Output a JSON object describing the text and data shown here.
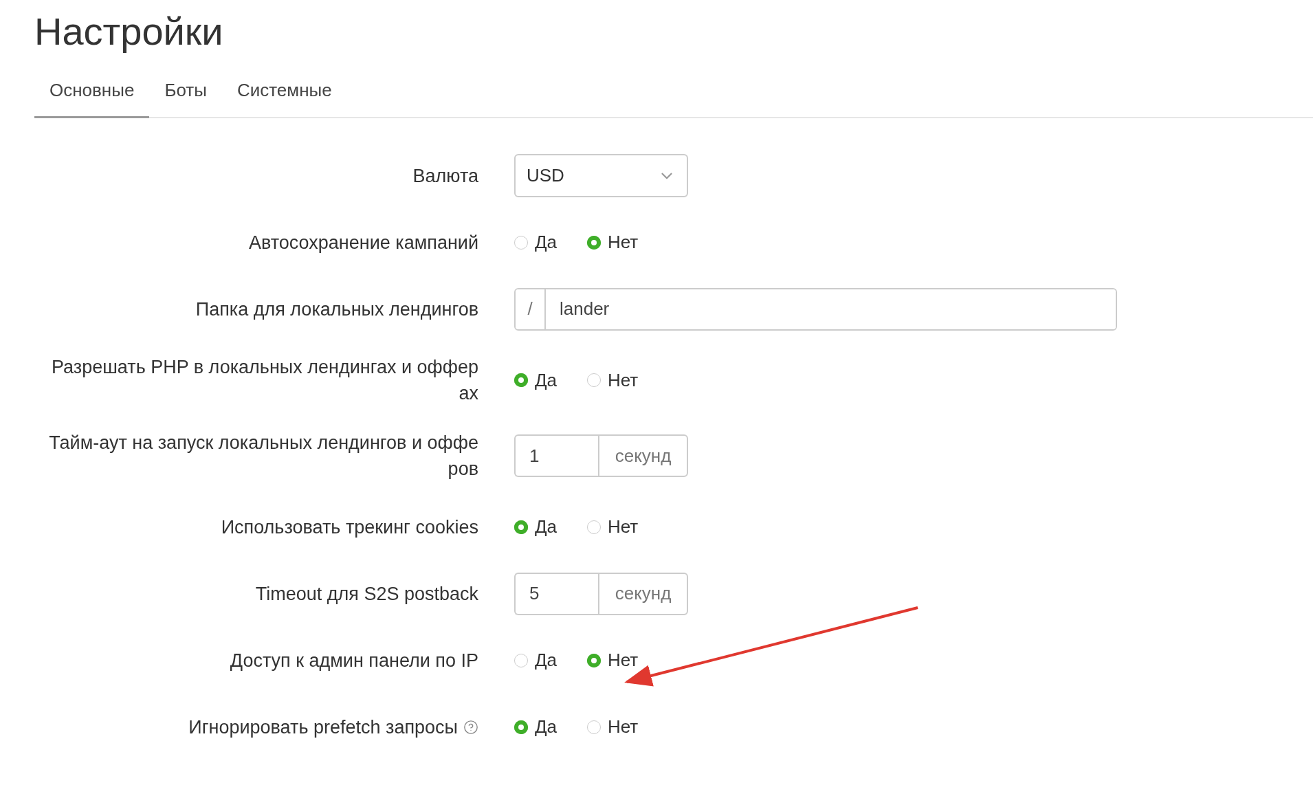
{
  "title": "Настройки",
  "tabs": [
    {
      "label": "Основные",
      "selected": true
    },
    {
      "label": "Боты",
      "selected": false
    },
    {
      "label": "Системные",
      "selected": false
    }
  ],
  "fields": [
    {
      "kind": "select",
      "label": "Валюта",
      "value": "USD"
    },
    {
      "kind": "radio",
      "label": "Автосохранение кампаний",
      "options": [
        {
          "label": "Да",
          "selected": false
        },
        {
          "label": "Нет",
          "selected": true
        }
      ]
    },
    {
      "kind": "prefix_input",
      "label": "Папка для локальных лендингов",
      "prefix": "/",
      "value": "lander"
    },
    {
      "kind": "radio",
      "label": "Разрешать PHP в локальных лендингах и офферах",
      "options": [
        {
          "label": "Да",
          "selected": true
        },
        {
          "label": "Нет",
          "selected": false
        }
      ]
    },
    {
      "kind": "suffix_input",
      "label": "Тайм-аут на запуск локальных лендингов и офферов",
      "value": "1",
      "suffix": "секунд"
    },
    {
      "kind": "radio",
      "label": "Использовать трекинг cookies",
      "options": [
        {
          "label": "Да",
          "selected": true
        },
        {
          "label": "Нет",
          "selected": false
        }
      ]
    },
    {
      "kind": "suffix_input",
      "label": "Timeout для S2S postback",
      "value": "5",
      "suffix": "секунд"
    },
    {
      "kind": "radio",
      "label": "Доступ к админ панели по IP",
      "options": [
        {
          "label": "Да",
          "selected": false
        },
        {
          "label": "Нет",
          "selected": true
        }
      ]
    },
    {
      "kind": "radio",
      "label": "Игнорировать prefetch запросы",
      "help": true,
      "options": [
        {
          "label": "Да",
          "selected": true
        },
        {
          "label": "Нет",
          "selected": false
        }
      ]
    }
  ],
  "annotation": {
    "kind": "arrow"
  }
}
